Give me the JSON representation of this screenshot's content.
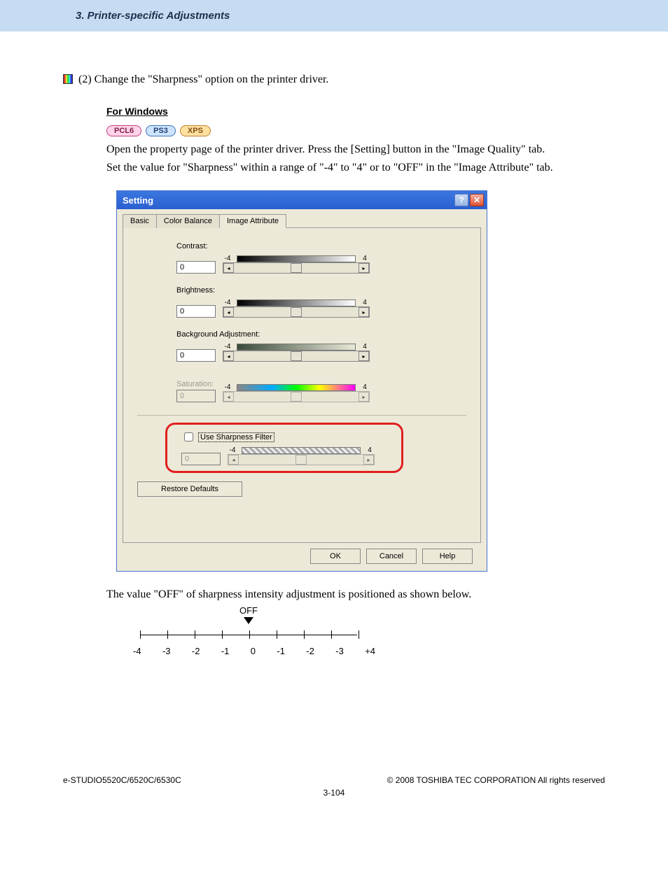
{
  "header": {
    "section_title": "3. Printer-specific Adjustments"
  },
  "step": {
    "text": "(2) Change the \"Sharpness\" option on the printer driver."
  },
  "for_windows_heading": "For Windows",
  "badges": {
    "pcl6": "PCL6",
    "ps3": "PS3",
    "xps": "XPS"
  },
  "instructions": {
    "line1": "Open the property page of the printer driver. Press the [Setting] button in the \"Image Quality\" tab.",
    "line2": "Set the value for \"Sharpness\" within a range of \"-4\" to \"4\" or to \"OFF\" in the \"Image Attribute\" tab."
  },
  "dialog": {
    "title": "Setting",
    "tabs": {
      "basic": "Basic",
      "color_balance": "Color Balance",
      "image_attribute": "Image Attribute"
    },
    "labels": {
      "contrast": "Contrast:",
      "brightness": "Brightness:",
      "background": "Background Adjustment:",
      "saturation": "Saturation:",
      "use_sharpness": "Use Sharpness Filter",
      "restore": "Restore Defaults"
    },
    "range": {
      "min": "-4",
      "max": "4"
    },
    "values": {
      "contrast": "0",
      "brightness": "0",
      "background": "0",
      "saturation": "0",
      "sharpness": "0"
    },
    "buttons": {
      "ok": "OK",
      "cancel": "Cancel",
      "help": "Help"
    }
  },
  "after_dialog_text": "The value \"OFF\" of sharpness intensity adjustment is positioned as shown below.",
  "scale": {
    "off_label": "OFF",
    "ticks": [
      "-4",
      "-3",
      "-2",
      "-1",
      "0",
      "-1",
      "-2",
      "-3",
      "+4"
    ]
  },
  "footer": {
    "left": "e-STUDIO5520C/6520C/6530C",
    "right": "© 2008 TOSHIBA TEC CORPORATION All rights reserved",
    "page": "3-104"
  },
  "chart_data": {
    "type": "table",
    "title": "Sharpness OFF position scale",
    "categories": [
      "-4",
      "-3",
      "-2",
      "-1",
      "0",
      "-1",
      "-2",
      "-3",
      "+4"
    ],
    "values": [
      -4,
      -3,
      -2,
      -1,
      0,
      -1,
      -2,
      -3,
      4
    ],
    "off_position_index": 4
  }
}
